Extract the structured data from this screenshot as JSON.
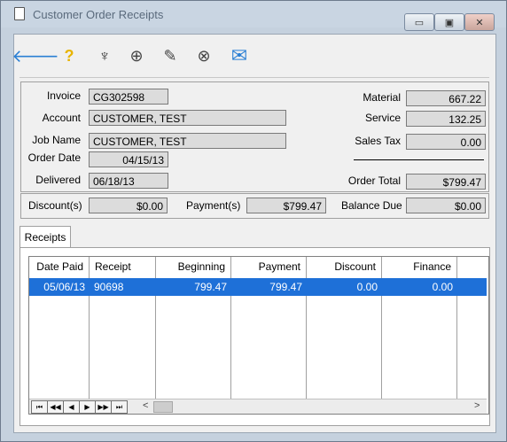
{
  "window": {
    "title": "Customer Order Receipts"
  },
  "titlebar_buttons": {
    "minimize": "▭",
    "maximize": "▣",
    "close": "✕"
  },
  "toolbar": {
    "back": "🡐",
    "help": "?",
    "tool": "♆",
    "new_doc": "⊕",
    "edit_doc": "✎",
    "delete_doc": "⊗",
    "email": "✉"
  },
  "order": {
    "invoice_label": "Invoice",
    "invoice": "CG302598",
    "account_label": "Account",
    "account": "CUSTOMER, TEST",
    "job_name_label": "Job Name",
    "job_name": "CUSTOMER, TEST",
    "order_date_label": "Order Date",
    "order_date": "04/15/13",
    "delivered_label": "Delivered",
    "delivered": "06/18/13"
  },
  "totals": {
    "material_label": "Material",
    "material": "667.22",
    "service_label": "Service",
    "service": "132.25",
    "sales_tax_label": "Sales Tax",
    "sales_tax": "0.00",
    "order_total_label": "Order Total",
    "order_total": "$799.47"
  },
  "summary": {
    "discounts_label": "Discount(s)",
    "discounts": "$0.00",
    "payments_label": "Payment(s)",
    "payments": "$799.47",
    "balance_due_label": "Balance Due",
    "balance_due": "$0.00"
  },
  "tabs": [
    {
      "label": "Receipts"
    }
  ],
  "receipts": {
    "columns": [
      "Date Paid",
      "Receipt",
      "Beginning",
      "Payment",
      "Discount",
      "Finance"
    ],
    "rows": [
      [
        "05/06/13",
        "90698",
        "799.47",
        "799.47",
        "0.00",
        "0.00"
      ]
    ]
  },
  "grid_nav": {
    "first": "⏮",
    "prev_page": "◀◀",
    "prev": "◀",
    "next": "▶",
    "next_page": "▶▶",
    "last": "⏭",
    "scroll_left": "<",
    "scroll_right": ">"
  },
  "colors": {
    "titlebar": "#c9d5e2",
    "selection": "#1e70d8",
    "accent_blue": "#2a7fd4",
    "help_yellow": "#e8b400"
  }
}
